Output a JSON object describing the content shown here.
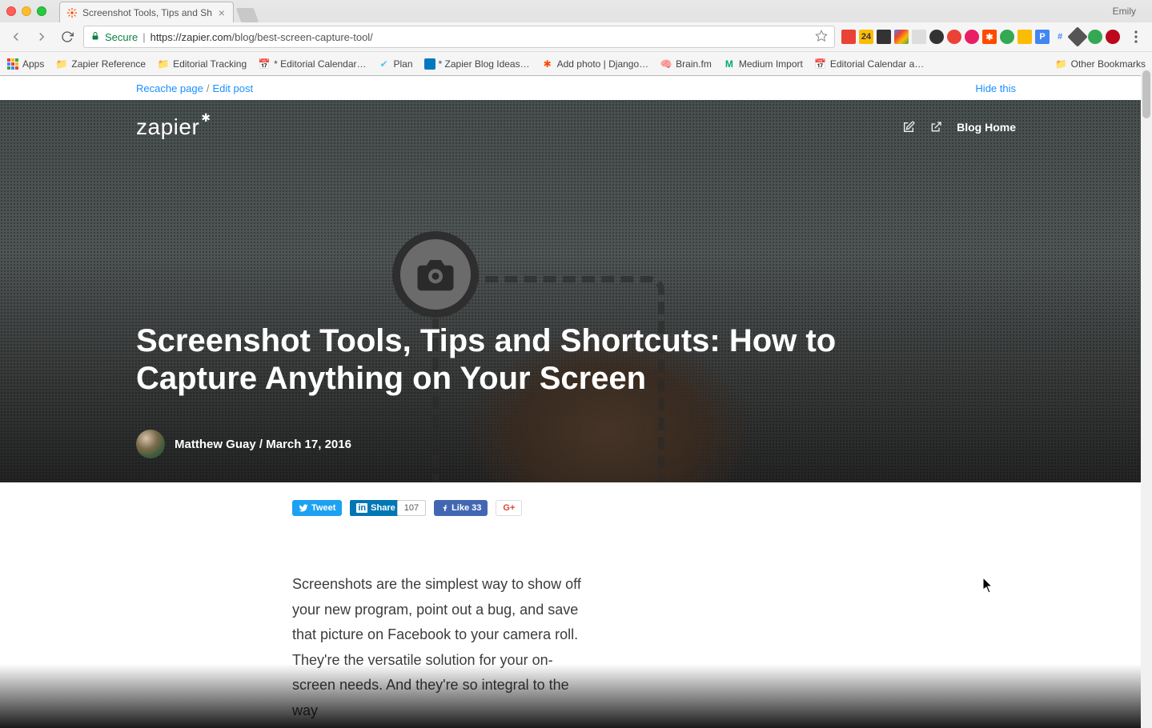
{
  "browser": {
    "user": "Emily",
    "tab": {
      "title": "Screenshot Tools, Tips and Sh"
    },
    "omnibox": {
      "secure_label": "Secure",
      "url_scheme_host": "https://zapier.com",
      "url_path": "/blog/best-screen-capture-tool/"
    },
    "bookmarks": {
      "apps": "Apps",
      "items": [
        "Zapier Reference",
        "Editorial Tracking",
        "* Editorial Calendar…",
        "Plan",
        "* Zapier Blog Ideas…",
        "Add photo | Django…",
        "Brain.fm",
        "Medium Import",
        "Editorial Calendar a…"
      ],
      "other": "Other Bookmarks"
    }
  },
  "admin_bar": {
    "recache": "Recache page",
    "edit": "Edit post",
    "hide": "Hide this"
  },
  "hero": {
    "logo": "zapier",
    "nav_home": "Blog Home",
    "title": "Screenshot Tools, Tips and Shortcuts: How to Capture Anything on Your Screen",
    "author": "Matthew Guay",
    "date": "March 17, 2016"
  },
  "share": {
    "tweet": "Tweet",
    "linkedin": "Share",
    "linkedin_count": "107",
    "fb_like": "Like 33"
  },
  "article": {
    "paragraph1": "Screenshots are the simplest way to show off your new program, point out a bug, and save that picture on Facebook to your camera roll. They're the versatile solution for your on-screen needs. And they're so integral to the way"
  }
}
